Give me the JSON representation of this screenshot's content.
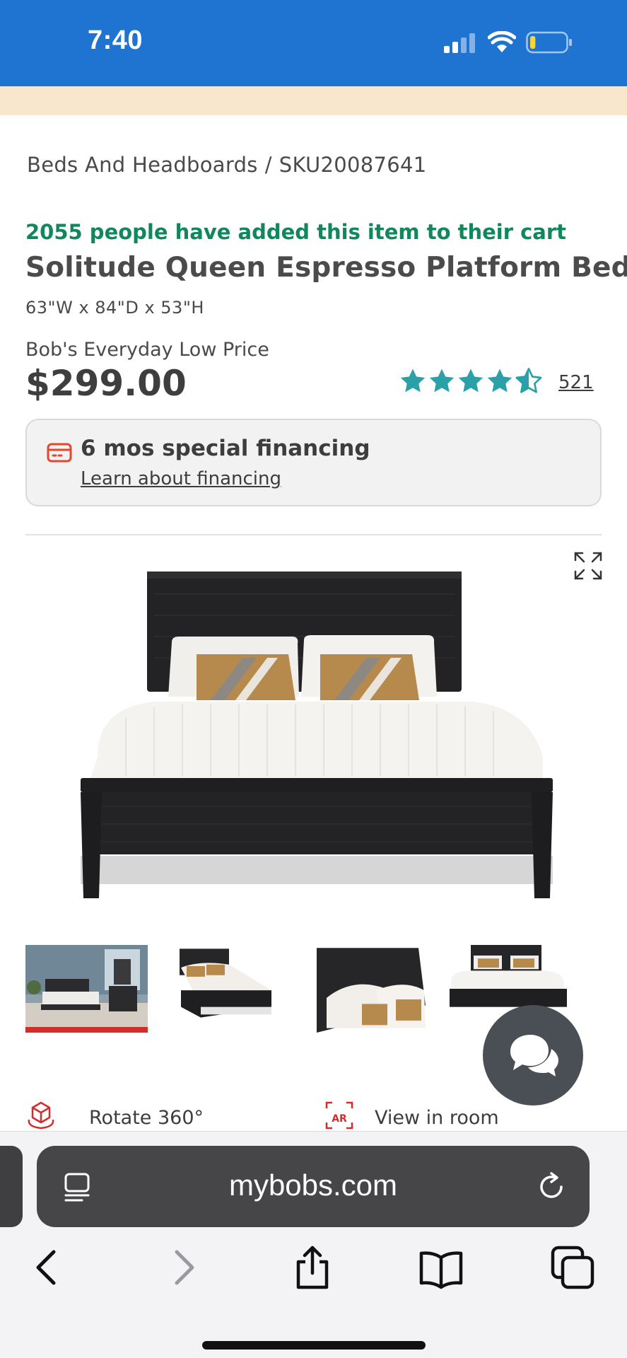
{
  "status_bar": {
    "time": "7:40",
    "signal_icon": "cellular-signal-icon",
    "wifi_icon": "wifi-icon",
    "battery_icon": "battery-low-icon",
    "battery_level": 0.15
  },
  "breadcrumb": {
    "category": "Beds And Headboards",
    "separator": "/",
    "sku": "SKU20087641"
  },
  "product": {
    "cart_note": "2055 people have added this item to their cart",
    "title": "Solitude Queen Espresso Platform Bed",
    "dimensions": "63\"W x 84\"D x 53\"H",
    "price_label": "Bob's Everyday Low Price",
    "price": "$299.00",
    "rating": 4.5,
    "review_count": "521"
  },
  "financing": {
    "icon": "credit-card-icon",
    "title": "6 mos special financing",
    "link_label": "Learn about financing"
  },
  "gallery": {
    "expand_icon": "expand-icon",
    "selected_thumbnail": 0,
    "thumbnails": [
      "room-scene",
      "bed-angled",
      "headboard-closeup",
      "bed-front"
    ]
  },
  "tools": {
    "rotate_label": "Rotate 360°",
    "room_label": "View in room"
  },
  "chat": {
    "icon": "chat-bubbles-icon"
  },
  "browser": {
    "url": "mybobs.com",
    "reader_icon": "reader-mode-icon",
    "reload_icon": "reload-icon",
    "nav": [
      "back-icon",
      "forward-icon",
      "share-icon",
      "bookmarks-icon",
      "tabs-icon"
    ]
  },
  "colors": {
    "status_bar": "#1f74d2",
    "promo_strip": "#f8e7cd",
    "cart_note_green": "#11875b",
    "star_teal": "#2aa0a8",
    "accent_red": "#d52b2b",
    "chat_button": "#4a4f56"
  }
}
